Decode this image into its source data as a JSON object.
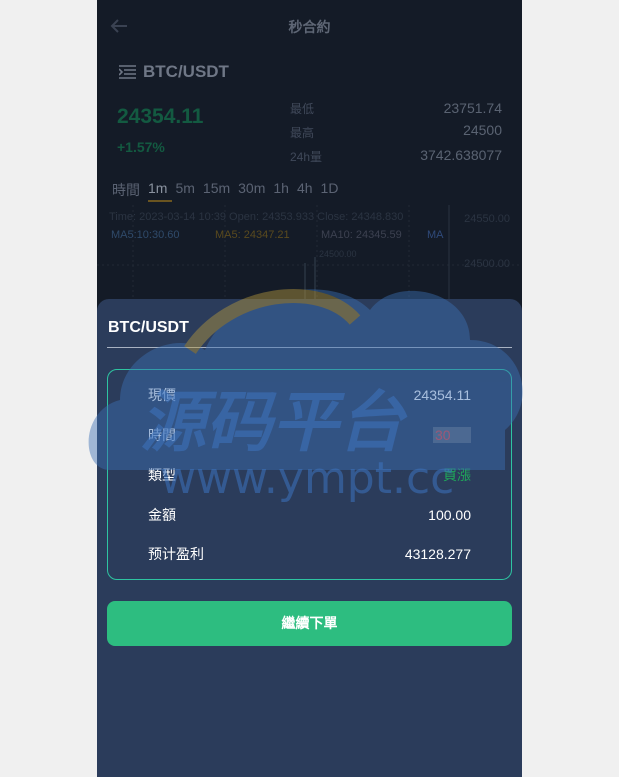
{
  "header": {
    "title": "秒合約",
    "back_icon": "arrow-left-icon"
  },
  "market": {
    "pair": "BTC/USDT",
    "price": "24354.11",
    "change": "+1.57%",
    "stats": [
      {
        "label": "最低",
        "value": "23751.74"
      },
      {
        "label": "最高",
        "value": "24500"
      },
      {
        "label": "24h量",
        "value": "3742.638077"
      }
    ]
  },
  "periods": [
    "時間",
    "1m",
    "5m",
    "15m",
    "30m",
    "1h",
    "4h",
    "1D"
  ],
  "kline": {
    "line1": "Time: 2023-03-14 10:39   Open: 24353.933   Close: 24348.830",
    "ma5": "MA5:10:30.60",
    "ma_mid": "MA5: 24347.21",
    "ma10": "MA10: 24345.59",
    "ma30_label": "MA",
    "axis_top": "24550.00",
    "axis_mid": "24500.00",
    "low_label": "24500.00"
  },
  "modal": {
    "title": "BTC/USDT",
    "rows": [
      {
        "label": "現價",
        "value": "24354.11"
      },
      {
        "label": "時間",
        "value": "30"
      },
      {
        "label": "類型",
        "value": "買漲"
      },
      {
        "label": "金額",
        "value": "100.00"
      },
      {
        "label": "预计盈利",
        "value": "43128.277"
      }
    ],
    "button_label": "繼續下單"
  },
  "watermark": {
    "line1": "源码平台",
    "line2": "www.ympt.cc"
  },
  "colors": {
    "accent_green": "#2dbd80",
    "border_teal": "#2ec4a1",
    "sheet_bg": "#2b3c5b",
    "up_red": "#e84646",
    "buy_green": "#1fa85a"
  }
}
